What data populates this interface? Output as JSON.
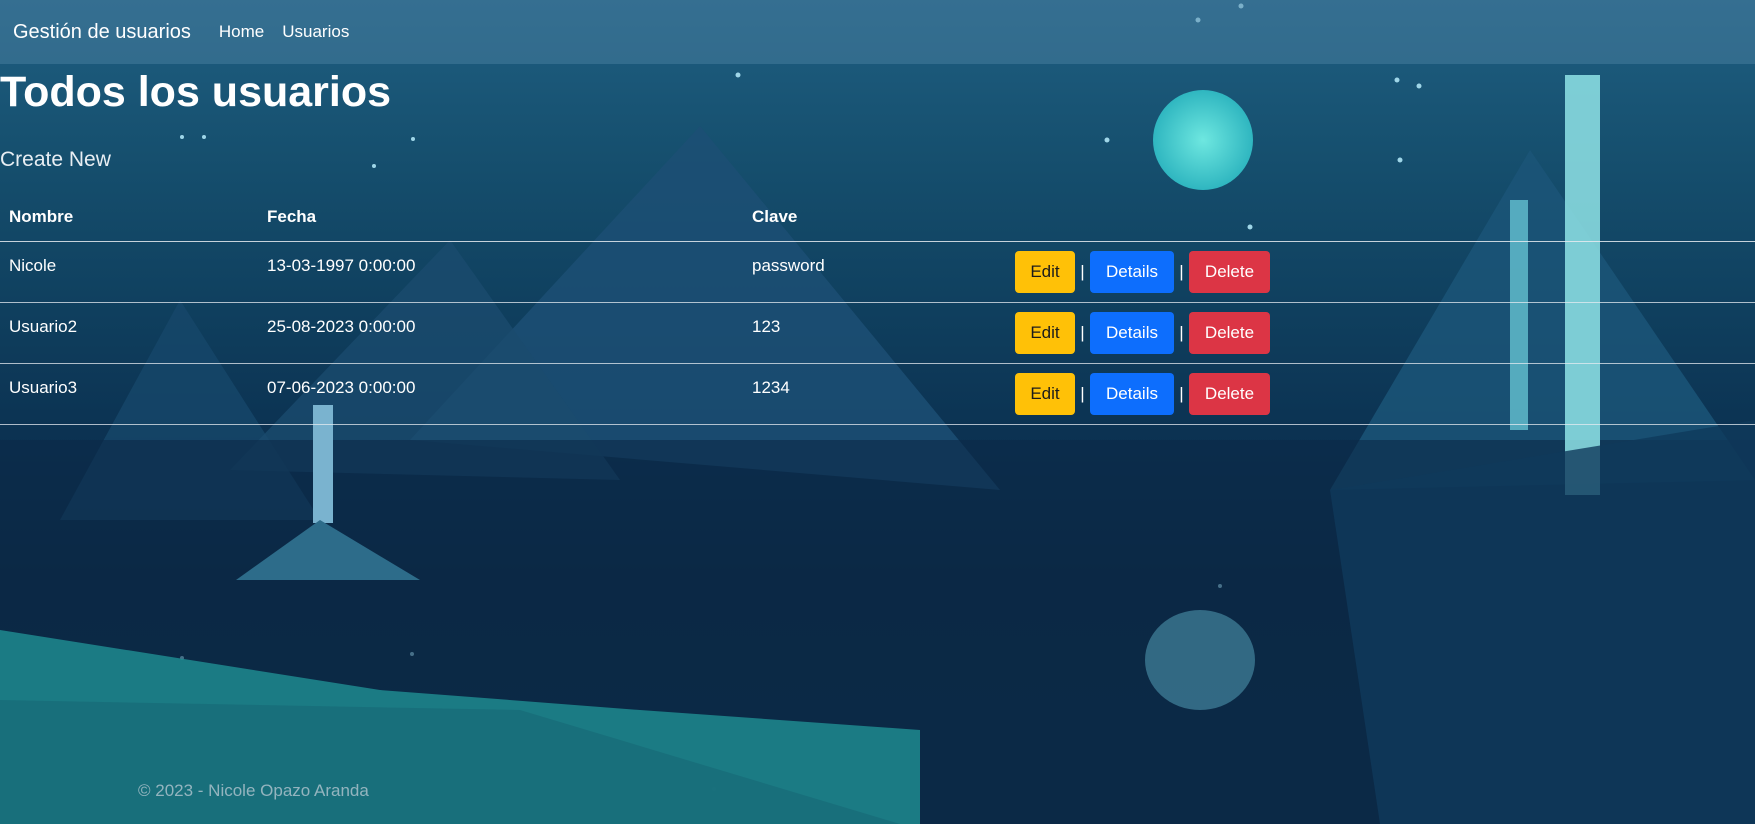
{
  "navbar": {
    "brand": "Gestión de usuarios",
    "links": [
      "Home",
      "Usuarios"
    ]
  },
  "page": {
    "title": "Todos los usuarios",
    "create_link": "Create New"
  },
  "table": {
    "headers": [
      "Nombre",
      "Fecha",
      "Clave",
      ""
    ],
    "rows": [
      {
        "nombre": "Nicole",
        "fecha": "13-03-1997 0:00:00",
        "clave": "password"
      },
      {
        "nombre": "Usuario2",
        "fecha": "25-08-2023 0:00:00",
        "clave": "123"
      },
      {
        "nombre": "Usuario3",
        "fecha": "07-06-2023 0:00:00",
        "clave": "1234"
      }
    ],
    "actions": {
      "edit": "Edit",
      "details": "Details",
      "delete": "Delete",
      "separator": "|"
    }
  },
  "footer": {
    "text": "© 2023 - Nicole Opazo Aranda"
  },
  "colors": {
    "edit": "#ffc107",
    "details": "#0d6efd",
    "delete": "#dc3545"
  }
}
